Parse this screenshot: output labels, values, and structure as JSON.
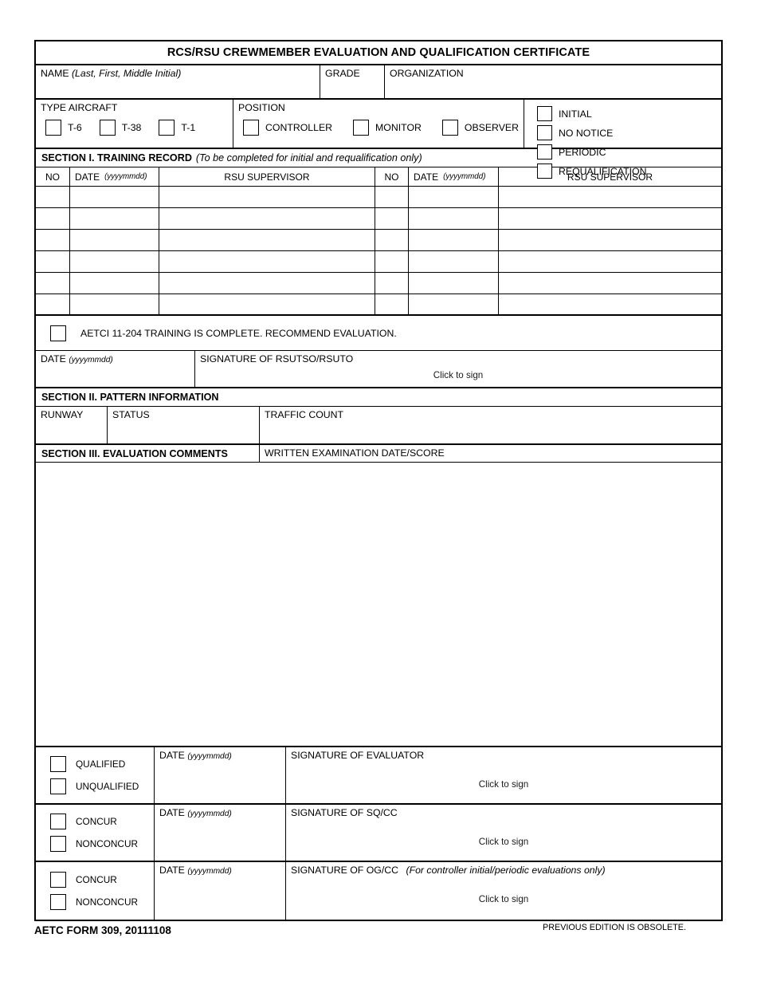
{
  "form": {
    "title": "RCS/RSU CREWMEMBER EVALUATION AND QUALIFICATION CERTIFICATE",
    "identity": {
      "name_label": "NAME",
      "name_hint": "(Last, First, Middle Initial)",
      "name_value": "",
      "grade_label": "GRADE",
      "grade_value": "",
      "organization_label": "ORGANIZATION",
      "organization_value": ""
    },
    "type_aircraft": {
      "label": "TYPE AIRCRAFT",
      "options": [
        "T-6",
        "T-38",
        "T-1"
      ]
    },
    "position": {
      "label": "POSITION",
      "options": [
        "CONTROLLER",
        "MONITOR",
        "OBSERVER"
      ]
    },
    "evaluation_type": {
      "options": [
        "INITIAL",
        "NO NOTICE",
        "PERIODIC",
        "REQUALIFICATION"
      ]
    },
    "section_i": {
      "heading": "SECTION I.  TRAINING RECORD",
      "heading_note": "(To be completed for initial and requalification only)",
      "columns": {
        "no": "NO",
        "date": "DATE",
        "date_hint": "(yyyymmdd)",
        "supervisor": "RSU SUPERVISOR"
      },
      "rows_left": [
        {
          "no": "",
          "date": "",
          "supervisor": ""
        },
        {
          "no": "",
          "date": "",
          "supervisor": ""
        },
        {
          "no": "",
          "date": "",
          "supervisor": ""
        },
        {
          "no": "",
          "date": "",
          "supervisor": ""
        },
        {
          "no": "",
          "date": "",
          "supervisor": ""
        },
        {
          "no": "",
          "date": "",
          "supervisor": ""
        }
      ],
      "rows_right": [
        {
          "no": "",
          "date": "",
          "supervisor": ""
        },
        {
          "no": "",
          "date": "",
          "supervisor": ""
        },
        {
          "no": "",
          "date": "",
          "supervisor": ""
        },
        {
          "no": "",
          "date": "",
          "supervisor": ""
        },
        {
          "no": "",
          "date": "",
          "supervisor": ""
        },
        {
          "no": "",
          "date": "",
          "supervisor": ""
        }
      ],
      "recommend_text": "AETCI 11-204 TRAINING IS COMPLETE.  RECOMMEND EVALUATION.",
      "date_label": "DATE",
      "date_hint": "(yyyymmdd)",
      "date_value": "",
      "signature_label": "SIGNATURE OF RSUTSO/RSUTO",
      "signature_placeholder": "Click to sign"
    },
    "section_ii": {
      "heading": "SECTION II.  PATTERN INFORMATION",
      "runway_label": "RUNWAY",
      "runway_value": "",
      "status_label": "STATUS",
      "status_value": "",
      "traffic_label": "TRAFFIC COUNT",
      "traffic_value": ""
    },
    "section_iii": {
      "heading": "SECTION III.  EVALUATION COMMENTS",
      "exam_label": "WRITTEN EXAMINATION DATE/SCORE",
      "exam_value": "",
      "comments_value": ""
    },
    "blocks": [
      {
        "name": "evaluator",
        "options": [
          "QUALIFIED",
          "UNQUALIFIED"
        ],
        "date_label": "DATE",
        "date_hint": "(yyyymmdd)",
        "date_value": "",
        "signature_label": "SIGNATURE OF EVALUATOR",
        "signature_note": "",
        "signature_placeholder": "Click to sign"
      },
      {
        "name": "sqcc",
        "options": [
          "CONCUR",
          "NONCONCUR"
        ],
        "date_label": "DATE",
        "date_hint": "(yyyymmdd)",
        "date_value": "",
        "signature_label": "SIGNATURE OF SQ/CC",
        "signature_note": "",
        "signature_placeholder": "Click to sign"
      },
      {
        "name": "ogcc",
        "options": [
          "CONCUR",
          "NONCONCUR"
        ],
        "date_label": "DATE",
        "date_hint": "(yyyymmdd)",
        "date_value": "",
        "signature_label": "SIGNATURE OF OG/CC",
        "signature_note": "(For controller initial/periodic evaluations only)",
        "signature_placeholder": "Click to sign"
      }
    ],
    "footer": {
      "form_id": "AETC FORM 309, 20111108",
      "edition_note": "PREVIOUS EDITION IS OBSOLETE."
    }
  }
}
